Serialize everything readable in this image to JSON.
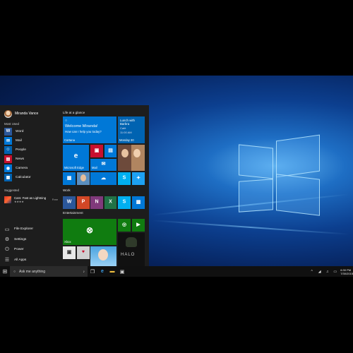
{
  "start_menu": {
    "user_name": "Miranda Vance",
    "most_used_header": "Most Used",
    "most_used": [
      {
        "label": "Word",
        "color": "#2b579a",
        "icon": "word-icon",
        "glyph": "W"
      },
      {
        "label": "Mail",
        "color": "#0078d7",
        "icon": "mail-icon",
        "glyph": "✉"
      },
      {
        "label": "People",
        "color": "#0063b1",
        "icon": "people-icon",
        "glyph": "☺"
      },
      {
        "label": "News",
        "color": "#c8102e",
        "icon": "news-icon",
        "glyph": "▤"
      },
      {
        "label": "Camera",
        "color": "#0078d7",
        "icon": "camera-icon",
        "glyph": "◉"
      },
      {
        "label": "Calculator",
        "color": "#0063b1",
        "icon": "calculator-icon",
        "glyph": "▦"
      }
    ],
    "suggested_header": "Suggested",
    "suggested": {
      "label": "Cars: Fast as Lightning",
      "rating": "★★★★",
      "price": "Free"
    },
    "bottom": [
      {
        "label": "File Explorer",
        "icon": "folder-icon",
        "glyph": "▭"
      },
      {
        "label": "Settings",
        "icon": "gear-icon",
        "glyph": "⚙"
      },
      {
        "label": "Power",
        "icon": "power-icon",
        "glyph": "⏻"
      },
      {
        "label": "All Apps",
        "icon": "list-icon",
        "glyph": "☰"
      }
    ]
  },
  "tiles": {
    "group_life": "Life at a glance",
    "group_work": "Work",
    "group_entertainment": "Entertainment",
    "cortana": {
      "greeting": "Welcome Miranda!",
      "question": "How can I help you today?",
      "label": "Cortana"
    },
    "calendar": {
      "event": "Lunch with Barbra",
      "place": "Café",
      "time": "11:00 AM",
      "date": "Monday 30"
    },
    "edge_label": "Microsoft Edge",
    "mail_label": "Mail",
    "xbox_label": "Xbox"
  },
  "taskbar": {
    "search_placeholder": "Ask me anything",
    "time": "6:30 PM",
    "date": "7/30/2015"
  },
  "colors": {
    "accent": "#0078d7",
    "start_bg": "#1d1d1d",
    "taskbar_bg": "#101010",
    "xbox_green": "#107c10"
  }
}
